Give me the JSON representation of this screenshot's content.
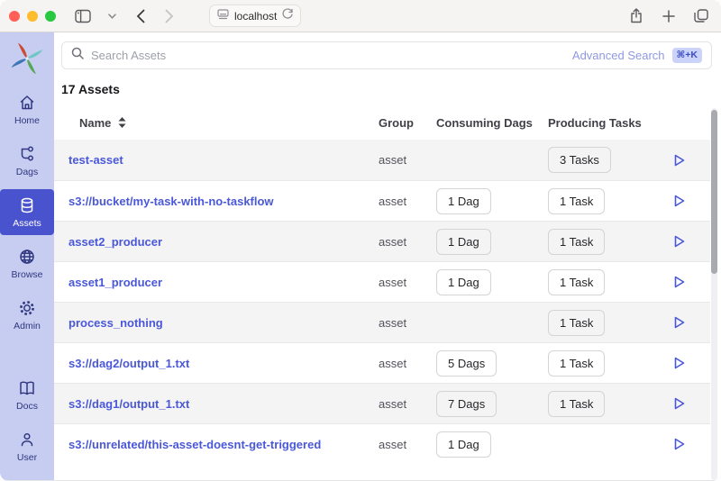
{
  "browser": {
    "url": "localhost",
    "traffic_lights": {
      "close": "#ff5f57",
      "minimize": "#febc2e",
      "zoom": "#28c840"
    }
  },
  "sidebar": {
    "items": [
      {
        "label": "Home",
        "icon": "home-icon",
        "active": false
      },
      {
        "label": "Dags",
        "icon": "dags-icon",
        "active": false
      },
      {
        "label": "Assets",
        "icon": "assets-icon",
        "active": true
      },
      {
        "label": "Browse",
        "icon": "browse-icon",
        "active": false
      },
      {
        "label": "Admin",
        "icon": "admin-icon",
        "active": false
      }
    ],
    "bottom_items": [
      {
        "label": "Docs",
        "icon": "docs-icon"
      },
      {
        "label": "User",
        "icon": "user-icon"
      }
    ]
  },
  "search": {
    "placeholder": "Search Assets",
    "advanced_label": "Advanced Search",
    "shortcut": "⌘+K"
  },
  "heading": "17 Assets",
  "table": {
    "columns": [
      "Name",
      "Group",
      "Consuming Dags",
      "Producing Tasks"
    ],
    "rows": [
      {
        "name": "test-asset",
        "group": "asset",
        "dags": "",
        "tasks": "3 Tasks"
      },
      {
        "name": "s3://bucket/my-task-with-no-taskflow",
        "group": "asset",
        "dags": "1 Dag",
        "tasks": "1 Task"
      },
      {
        "name": "asset2_producer",
        "group": "asset",
        "dags": "1 Dag",
        "tasks": "1 Task"
      },
      {
        "name": "asset1_producer",
        "group": "asset",
        "dags": "1 Dag",
        "tasks": "1 Task"
      },
      {
        "name": "process_nothing",
        "group": "asset",
        "dags": "",
        "tasks": "1 Task"
      },
      {
        "name": "s3://dag2/output_1.txt",
        "group": "asset",
        "dags": "5 Dags",
        "tasks": "1 Task"
      },
      {
        "name": "s3://dag1/output_1.txt",
        "group": "asset",
        "dags": "7 Dags",
        "tasks": "1 Task"
      },
      {
        "name": "s3://unrelated/this-asset-doesnt-get-triggered",
        "group": "asset",
        "dags": "1 Dag",
        "tasks": ""
      }
    ]
  },
  "colors": {
    "accent": "#4a53ce",
    "link": "#4a58d8",
    "sidebar_bg": "#c6cdf1",
    "row_alt": "#f4f4f5",
    "logo": {
      "red": "#cc4b33",
      "teal": "#6fc6c4",
      "green": "#54a857",
      "blue": "#3f76b5"
    }
  }
}
